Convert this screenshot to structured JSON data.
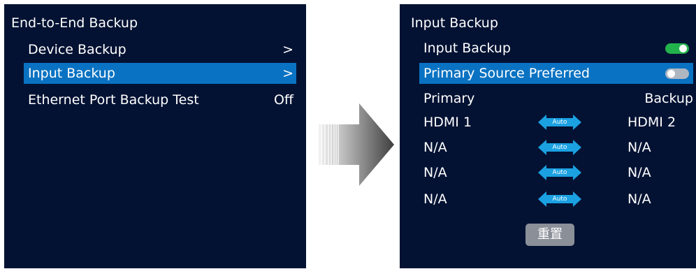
{
  "left_screen": {
    "title": "End-to-End Backup",
    "items": [
      {
        "label": "Device Backup",
        "value": ">"
      },
      {
        "label": "Input Backup",
        "value": ">",
        "selected": true
      },
      {
        "label": "Ethernet Port Backup Test",
        "value": "Off"
      }
    ]
  },
  "right_screen": {
    "title": "Input Backup",
    "input_backup": {
      "label": "Input Backup",
      "toggle_on": true
    },
    "primary_source_preferred": {
      "label": "Primary Source Preferred",
      "toggle_on": false,
      "selected": true
    },
    "headers": {
      "primary": "Primary",
      "backup": "Backup"
    },
    "pairs": [
      {
        "primary": "HDMI 1",
        "mode": "Auto",
        "backup": "HDMI 2"
      },
      {
        "primary": "N/A",
        "mode": "Auto",
        "backup": "N/A"
      },
      {
        "primary": "N/A",
        "mode": "Auto",
        "backup": "N/A"
      },
      {
        "primary": "N/A",
        "mode": "Auto",
        "backup": "N/A"
      }
    ],
    "reset_label": "重置"
  },
  "colors": {
    "screen_bg": "#031233",
    "selection": "#0a72c2",
    "toggle_on": "#22b24c",
    "toggle_off": "#aeb6c2",
    "auto_arrow": "#1ba1e2",
    "reset_bg": "#8a8f98"
  },
  "icons": {
    "transition": "right-arrow-icon",
    "auto": "double-arrow-icon"
  }
}
